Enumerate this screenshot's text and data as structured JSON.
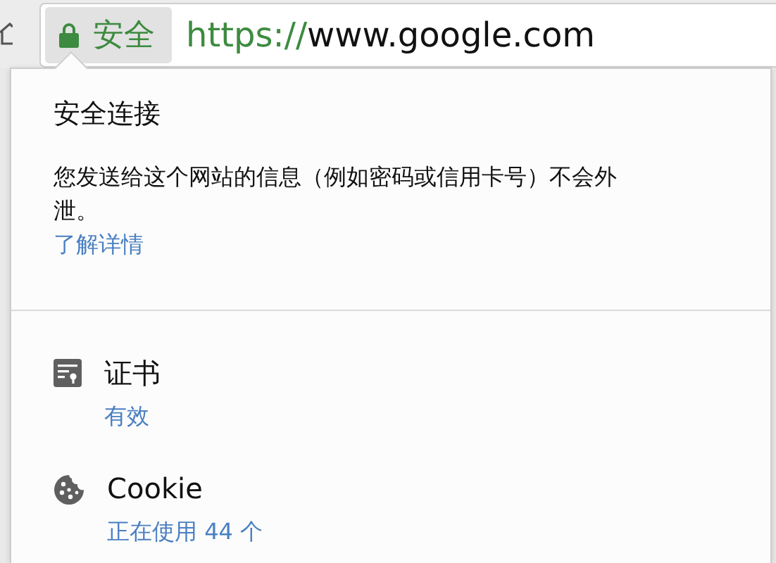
{
  "address_bar": {
    "security_label": "安全",
    "url_scheme": "https://",
    "url_host": "www.google.com"
  },
  "popup": {
    "title": "安全连接",
    "description": "您发送给这个网站的信息（例如密码或信用卡号）不会外泄。",
    "link": "了解详情",
    "items": [
      {
        "kind": "certificate",
        "label": "证书",
        "status": "有效"
      },
      {
        "kind": "cookie",
        "label": "Cookie",
        "status": "正在使用 44 个"
      }
    ]
  }
}
